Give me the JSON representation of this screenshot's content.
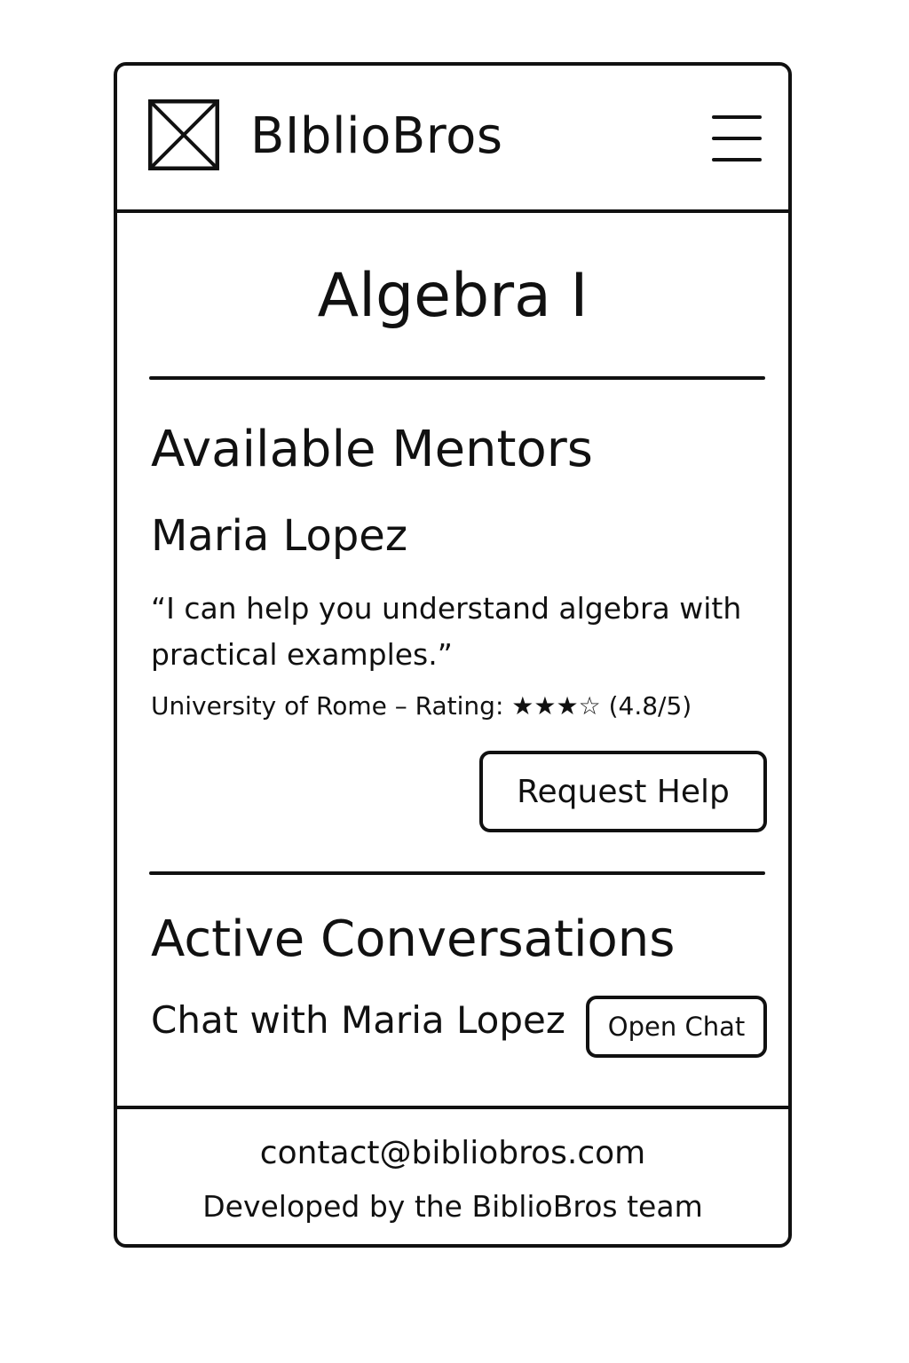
{
  "header": {
    "brand": "BIblioBros",
    "logo_icon": "image-placeholder-icon",
    "menu_icon": "hamburger-menu-icon"
  },
  "page": {
    "title": "Algebra I"
  },
  "mentors": {
    "heading": "Available Mentors",
    "items": [
      {
        "name": "Maria Lopez",
        "quote": "“I can help you understand algebra with practical examples.”",
        "meta": "University of Rome – Rating: ★★★☆ (4.8/5)",
        "button_label": "Request Help"
      }
    ]
  },
  "conversations": {
    "heading": "Active Conversations",
    "items": [
      {
        "label": "Chat with Maria Lopez",
        "button_label": "Open Chat"
      }
    ]
  },
  "footer": {
    "email": "contact@bibliobros.com",
    "credit": "Developed by the BiblioBros team"
  }
}
